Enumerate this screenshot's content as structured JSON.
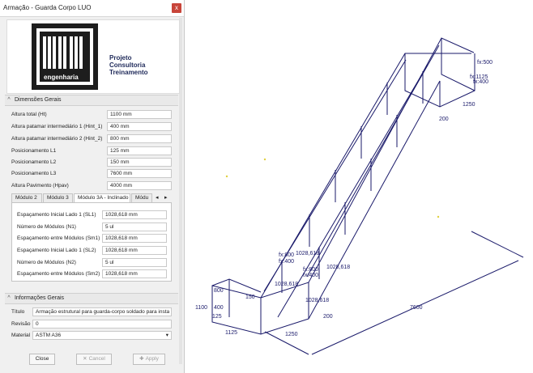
{
  "window": {
    "title": "Armação - Guarda Corpo LUO",
    "close_glyph": "x"
  },
  "logo": {
    "icon": "anm-logo-icon",
    "wordmark": "engenharia",
    "tagline": [
      "Projeto",
      "Consultoria",
      "Treinamento"
    ]
  },
  "dimensoes": {
    "header": "Dimensões Gerais",
    "chevron": "^",
    "fields": [
      {
        "label": "Altura total (Ht)",
        "value": "1100 mm"
      },
      {
        "label": "Altura patamar intermediário 1 (Hint_1)",
        "value": "400 mm"
      },
      {
        "label": "Altura patamar intermediário 2 (Hint_2)",
        "value": "800 mm"
      },
      {
        "label": "Posicionamento L1",
        "value": "125 mm"
      },
      {
        "label": "Posicionamento L2",
        "value": "150 mm"
      },
      {
        "label": "Posicionamento L3",
        "value": "7600 mm"
      },
      {
        "label": "Altura Pavimento (Hpav)",
        "value": "4000 mm"
      }
    ]
  },
  "tabs": {
    "items": [
      "Módulo 2",
      "Módulo 3",
      "Módulo 3A - Inclinado",
      "Módu"
    ],
    "active_index": 2,
    "prev": "◂",
    "next": "▸",
    "panel_fields": [
      {
        "label": "Espaçamento Inicial Lado 1 (SL1)",
        "value": "1028,618 mm"
      },
      {
        "label": "Número de Módulos (N1)",
        "value": "5 ul"
      },
      {
        "label": "Espaçamento entre Módulos (Sm1)",
        "value": "1028,618 mm"
      },
      {
        "label": "Espaçamento Inicial Lado 1 (SL2)",
        "value": "1028,618 mm"
      },
      {
        "label": "Número de Módulos (N2)",
        "value": "5 ul"
      },
      {
        "label": "Espaçamento entre Módulos (Sm2)",
        "value": "1028,618 mm"
      }
    ]
  },
  "info": {
    "header": "Informações Gerais",
    "chevron": "^",
    "titulo_label": "Título",
    "titulo_value": "Armação estrutural para guarda-corpo soldado para insta",
    "revisao_label": "Revisão",
    "revisao_value": "0",
    "material_label": "Material",
    "material_value": "ASTM A36",
    "material_caret": "▾"
  },
  "buttons": {
    "close": "Close",
    "cancel": "Cancel",
    "apply": "Apply",
    "cancel_icon": "✕",
    "apply_icon": "✚"
  },
  "drawing": {
    "labels": {
      "d7600": "7600",
      "d1250_bottom": "1250",
      "d1125_bottom": "1125",
      "d200_bottom": "200",
      "d150": "150",
      "d800_left": "800",
      "d1100": "1100",
      "d400_left": "400",
      "d125": "125",
      "top_fx500": "fx:500",
      "top_fx1125": "fx:1125",
      "top_fx400": "fx:400",
      "top_1250": "1250",
      "top_200": "200",
      "fx800_a": "fx:800",
      "fx400_a": "fx:400",
      "mod_a": "1028,618",
      "fx800_b": "fx:800",
      "fx400_b": "fx:400",
      "mod_b": "1028,618",
      "mod_c": "1028,618",
      "mod_d": "1028,618"
    },
    "line_color": "#1a1a6a"
  }
}
